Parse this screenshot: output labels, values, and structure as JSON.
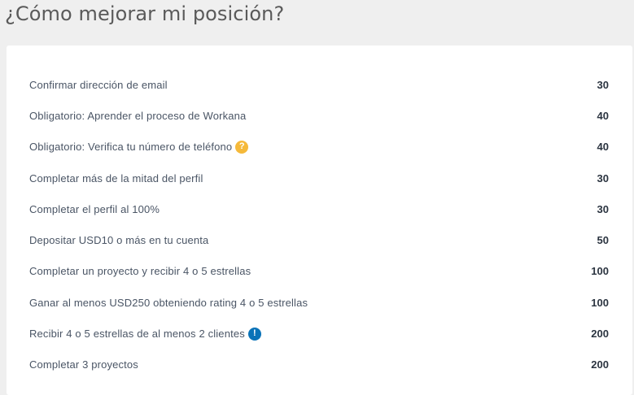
{
  "page": {
    "title": "¿Cómo mejorar mi posición?"
  },
  "items": [
    {
      "label": "Confirmar dirección de email",
      "points": "30"
    },
    {
      "label": "Obligatorio: Aprender el proceso de Workana",
      "points": "40"
    },
    {
      "label": "Obligatorio: Verifica tu número de teléfono",
      "points": "40",
      "badge": {
        "icon": "question-icon",
        "glyph": "?",
        "color": "#f5b93a"
      }
    },
    {
      "label": "Completar más de la mitad del perfil",
      "points": "30"
    },
    {
      "label": "Completar el perfil al 100%",
      "points": "30"
    },
    {
      "label": "Depositar USD10 o más en tu cuenta",
      "points": "50"
    },
    {
      "label": "Completar un proyecto y recibir 4 o 5 estrellas",
      "points": "100"
    },
    {
      "label": "Ganar al menos USD250 obteniendo rating 4 o 5 estrellas",
      "points": "100"
    },
    {
      "label": "Recibir 4 o 5 estrellas de al menos 2 clientes",
      "points": "200",
      "badge": {
        "icon": "exclamation-icon",
        "glyph": "!",
        "color": "#0a73b8"
      }
    },
    {
      "label": "Completar 3 proyectos",
      "points": "200"
    }
  ]
}
